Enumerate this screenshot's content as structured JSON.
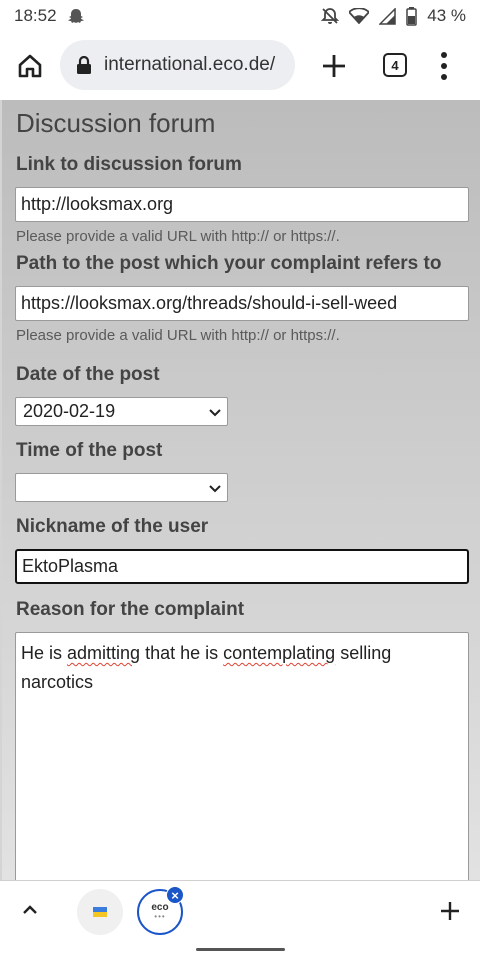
{
  "status_bar": {
    "time": "18:52",
    "battery": "43 %",
    "icons": [
      "snapchat-ghost-icon",
      "mute-bell-icon",
      "wifi-icon",
      "signal-icon",
      "battery-icon"
    ]
  },
  "browser": {
    "url": "international.eco.de/",
    "tab_count": "4",
    "icons": [
      "home-icon",
      "lock-icon",
      "new-tab-plus-icon",
      "tab-switcher-icon",
      "more-vert-icon"
    ]
  },
  "form": {
    "section_title": "Discussion forum",
    "link_label": "Link to discussion forum",
    "link_value": "http://looksmax.org",
    "link_hint": "Please provide a valid URL with http:// or https://.",
    "path_label": "Path to the post which your complaint refers to",
    "path_value": "https://looksmax.org/threads/should-i-sell-weed",
    "path_hint": "Please provide a valid URL with http:// or https://.",
    "date_label": "Date of the post",
    "date_value": "2020-02-19",
    "time_label": "Time of the post",
    "time_value": "",
    "nickname_label": "Nickname of the user",
    "nickname_value": "EktoPlasma",
    "reason_label": "Reason for the complaint",
    "reason_parts": [
      "He is ",
      "admitting",
      " that he is ",
      "contemplating",
      " selling narcotics"
    ]
  },
  "tab_strip": {
    "tab2_label": "eco",
    "close_symbol": "×"
  },
  "colors": {
    "accent": "#1a56c8",
    "spell_error": "#dd3322"
  }
}
